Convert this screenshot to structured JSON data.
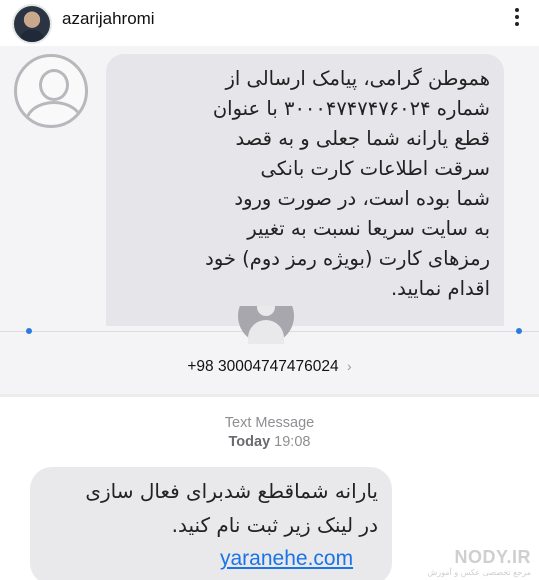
{
  "instagram": {
    "username": "azarijahromi",
    "more_icon": "ellipsis-vertical-icon"
  },
  "sms_top": {
    "message": "هموطن گرامی، پیامک ارسالی از\nشماره ۳۰۰۰۴۷۴۷۴۷۶۰۲۴ با عنوان\nقطع یارانه شما جعلی و به قصد\nسرقت اطلاعات کارت بانکی\nشما بوده است، در صورت ورود\nبه سایت سریعا نسبت به تغییر\nرمزهای کارت (بویژه رمز دوم) خود\nاقدام نمایید.",
    "sender_number": "+98 30004747476024",
    "sender_chevron": "›"
  },
  "sms_bottom": {
    "message_type": "Text Message",
    "day": "Today",
    "time": "19:08",
    "line1": "یارانه شماقطع شدبرای فعال سازی",
    "line2": "در لینک زیر ثبت نام کنید.",
    "link": "yaranehe.com"
  },
  "watermark": {
    "main": "NODY.IR",
    "sub": "مرجع تخصصی عکس و آموزش"
  },
  "colors": {
    "bubble": "#e5e5ea",
    "link": "#1a73e8",
    "meta_gray": "#8e8e93",
    "blue_dot": "#2a7bdc"
  }
}
